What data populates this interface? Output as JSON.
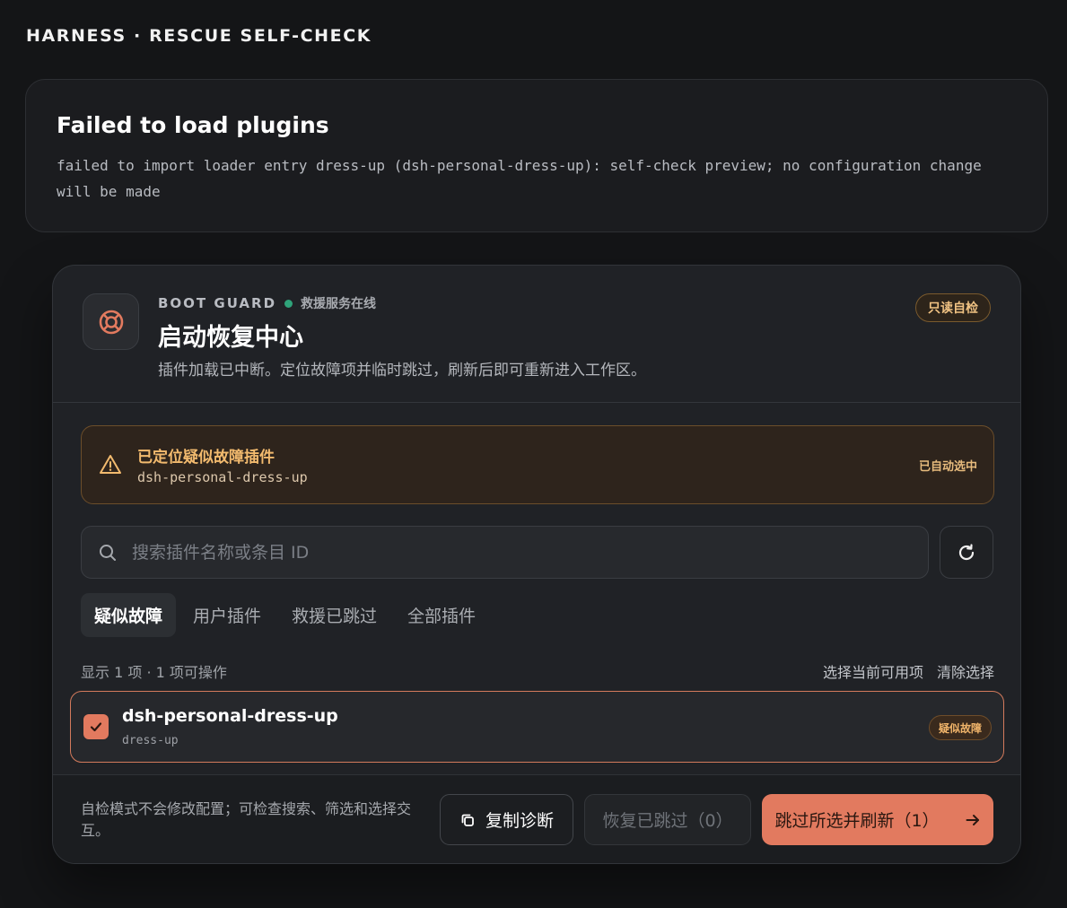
{
  "app": {
    "title": "HARNESS · RESCUE SELF-CHECK"
  },
  "error": {
    "title": "Failed to load plugins",
    "message": "failed to import loader entry dress-up (dsh-personal-dress-up): self-check preview; no configuration change will be made"
  },
  "panel": {
    "kicker": "BOOT GUARD",
    "status_text": "救援服务在线",
    "title": "启动恢复中心",
    "subtitle": "插件加载已中断。定位故障项并临时跳过，刷新后即可重新进入工作区。",
    "readonly_badge": "只读自检",
    "colors": {
      "accent": "#e27a5f",
      "warning": "#f2ba6e",
      "online": "#2fa37a"
    }
  },
  "alert": {
    "title": "已定位疑似故障插件",
    "plugin_id": "dsh-personal-dress-up",
    "status": "已自动选中"
  },
  "search": {
    "placeholder": "搜索插件名称或条目 ID",
    "value": ""
  },
  "tabs": [
    {
      "label": "疑似故障",
      "active": true
    },
    {
      "label": "用户插件",
      "active": false
    },
    {
      "label": "救援已跳过",
      "active": false
    },
    {
      "label": "全部插件",
      "active": false
    }
  ],
  "list": {
    "meta": "显示 1 项 · 1 项可操作",
    "select_available": "选择当前可用项",
    "clear_selection": "清除选择",
    "items": [
      {
        "name": "dsh-personal-dress-up",
        "entry": "dress-up",
        "badge": "疑似故障",
        "checked": true
      }
    ]
  },
  "footer": {
    "note": "自检模式不会修改配置；可检查搜索、筛选和选择交互。",
    "copy_label": "复制诊断",
    "restore_label": "恢复已跳过（0）",
    "skip_label": "跳过所选并刷新（1）"
  },
  "icons": {
    "logo": "lifebuoy-icon",
    "alert": "warning-triangle-icon",
    "search": "search-icon",
    "refresh": "refresh-icon",
    "checkbox": "check-icon",
    "copy": "copy-icon",
    "arrow": "arrow-right-icon"
  }
}
